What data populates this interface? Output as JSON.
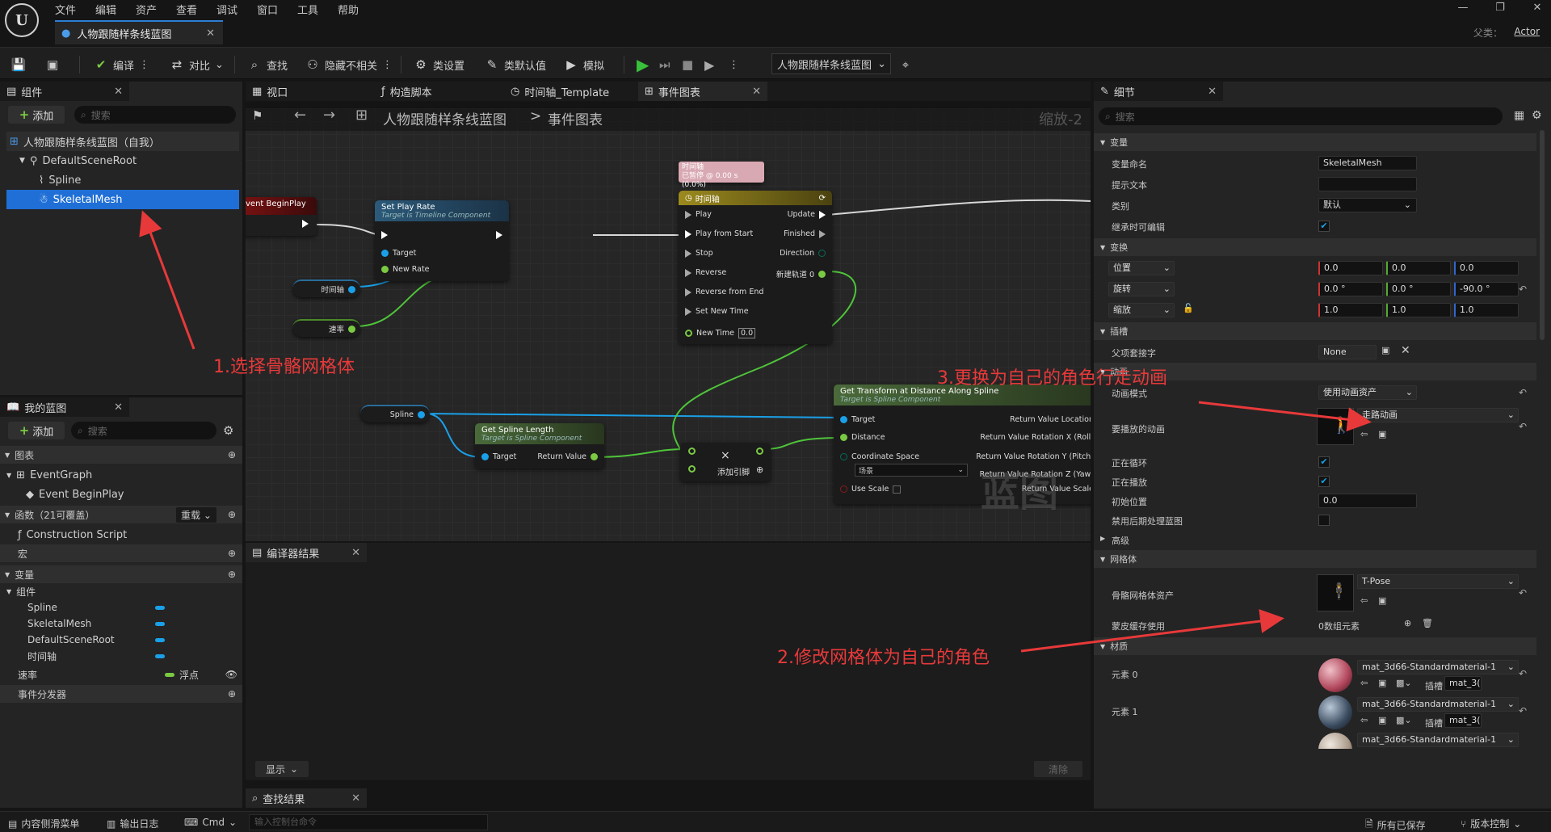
{
  "menu": [
    "文件",
    "编辑",
    "资产",
    "查看",
    "调试",
    "窗口",
    "工具",
    "帮助"
  ],
  "doc_tab": {
    "title": "人物跟随样条线蓝图"
  },
  "parent": {
    "label": "父类：",
    "value": "Actor"
  },
  "toolbar": {
    "save": "",
    "compile": "编译",
    "diff": "对比",
    "find": "查找",
    "hide_unrelated": "隐藏不相关",
    "class_settings": "类设置",
    "class_defaults": "类默认值",
    "simulate": "模拟",
    "debug_object": "人物跟随样条线蓝图"
  },
  "components": {
    "tab": "组件",
    "add": "添加",
    "search_placeholder": "搜索",
    "tree": [
      {
        "label": "人物跟随样条线蓝图（自我）",
        "icon": "blueprint-icon"
      },
      {
        "label": "DefaultSceneRoot",
        "icon": "scene-root-icon"
      },
      {
        "label": "Spline",
        "icon": "spline-icon"
      },
      {
        "label": "SkeletalMesh",
        "icon": "skeletal-mesh-icon",
        "selected": true
      }
    ]
  },
  "my_blueprint": {
    "tab": "我的蓝图",
    "add": "添加",
    "search_placeholder": "搜索",
    "graphs_header": "图表",
    "event_graph": "EventGraph",
    "event_begin_play": "Event BeginPlay",
    "functions_header": "函数（21可覆盖）",
    "override": "重载",
    "construction_script": "Construction Script",
    "macros_header": "宏",
    "variables_header": "变量",
    "components_group": "组件",
    "component_vars": [
      "Spline",
      "SkeletalMesh",
      "DefaultSceneRoot",
      "时间轴"
    ],
    "speed_var": "速率",
    "speed_type": "浮点",
    "dispatchers_header": "事件分发器"
  },
  "editor_tabs": [
    {
      "label": "视口",
      "icon": "grid-icon"
    },
    {
      "label": "构造脚本",
      "icon": "function-icon"
    },
    {
      "label": "时间轴_Template",
      "icon": "clock-icon"
    },
    {
      "label": "事件图表",
      "icon": "graph-icon",
      "active": true
    }
  ],
  "graph": {
    "breadcrumb_root": "人物跟随样条线蓝图",
    "breadcrumb_sep": ">",
    "breadcrumb_leaf": "事件图表",
    "zoom": "缩放-2",
    "watermark": "蓝图",
    "nodes": {
      "begin_play": "vent BeginPlay",
      "set_play_rate": {
        "title": "Set Play Rate",
        "sub": "Target is Timeline Component",
        "target": "Target",
        "new_rate": "New Rate"
      },
      "timeline_var": "时间轴",
      "speed_var": "速率",
      "timeline_comment": "时间轴\n已暂停 @ 0.00 s (0.0%)",
      "timeline": {
        "title": "时间轴",
        "play": "Play",
        "play_from_start": "Play from Start",
        "stop": "Stop",
        "reverse": "Reverse",
        "reverse_from_end": "Reverse from End",
        "set_new_time": "Set New Time",
        "new_time": "New Time",
        "new_time_value": "0.0",
        "update": "Update",
        "finished": "Finished",
        "direction": "Direction",
        "new_track": "新建轨道 0"
      },
      "spline_var": "Spline",
      "get_spline_length": {
        "title": "Get Spline Length",
        "sub": "Target is Spline Component",
        "target": "Target",
        "return": "Return Value"
      },
      "multiply": {
        "symbol": "×",
        "add_pin": "添加引脚"
      },
      "get_transform": {
        "title": "Get Transform at Distance Along Spline",
        "sub": "Target is Spline Component",
        "target": "Target",
        "distance": "Distance",
        "coord_space": "Coordinate Space",
        "coord_value": "场景",
        "use_scale": "Use Scale",
        "rv_location": "Return Value Location",
        "rv_rot_x": "Return Value Rotation X (Roll)",
        "rv_rot_y": "Return Value Rotation Y (Pitch)",
        "rv_rot_z": "Return Value Rotation Z (Yaw)",
        "rv_scale": "Return Value Scale"
      }
    }
  },
  "compiler": {
    "tab": "编译器结果",
    "show": "显示",
    "clear": "清除"
  },
  "find_results": {
    "tab": "查找结果"
  },
  "details": {
    "tab": "细节",
    "search_placeholder": "搜索",
    "variable_header": "变量",
    "var_name_label": "变量命名",
    "var_name_value": "SkeletalMesh",
    "tooltip_label": "提示文本",
    "category_label": "类别",
    "category_value": "默认",
    "editable_label": "继承时可编辑",
    "transform_header": "变换",
    "location_label": "位置",
    "rotation_label": "旋转",
    "scale_label": "缩放",
    "location": [
      "0.0",
      "0.0",
      "0.0"
    ],
    "rotation": [
      "0.0 °",
      "0.0 °",
      "-90.0 °"
    ],
    "scale": [
      "1.0",
      "1.0",
      "1.0"
    ],
    "sockets_header": "插槽",
    "parent_socket_label": "父项套接字",
    "parent_socket_value": "None",
    "animation_header": "动画",
    "anim_mode_label": "动画模式",
    "anim_mode_value": "使用动画资产",
    "anim_to_play_label": "要播放的动画",
    "anim_to_play_value": "走路动画",
    "looping_label": "正在循环",
    "playing_label": "正在播放",
    "initial_pos_label": "初始位置",
    "initial_pos_value": "0.0",
    "disable_post_label": "禁用后期处理蓝图",
    "advanced_header": "高级",
    "mesh_header": "网格体",
    "skeletal_asset_label": "骨骼网格体资产",
    "skeletal_asset_value": "T-Pose",
    "skin_cache_label": "蒙皮缓存使用",
    "skin_cache_value": "0数组元素",
    "materials_header": "材质",
    "element0_label": "元素 0",
    "element1_label": "元素 1",
    "material_value": "mat_3d66-Standardmaterial-1",
    "slot_label": "插槽",
    "slot_value": "mat_3("
  },
  "annotations": {
    "a1": "1.选择骨骼网格体",
    "a2": "2.修改网格体为自己的角色",
    "a3": "3.更换为自己的角色行走动画"
  },
  "statusbar": {
    "content_drawer": "内容侧滑菜单",
    "output_log": "输出日志",
    "cmd": "Cmd",
    "console_placeholder": "输入控制台命令",
    "all_saved": "所有已保存",
    "version_control": "版本控制"
  },
  "colors": {
    "accent": "#1f6fd6",
    "annotation": "#e8393a",
    "exec": "#ffffff",
    "object_pin": "#1aa0e8",
    "float_pin": "#7ac943"
  }
}
